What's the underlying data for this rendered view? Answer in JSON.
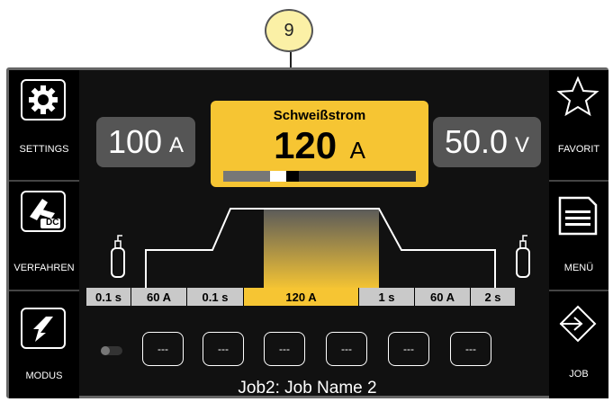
{
  "callout": {
    "number": "9"
  },
  "left_menu": [
    {
      "label": "SETTINGS",
      "icon": "gear-icon"
    },
    {
      "label": "VERFAHREN",
      "icon": "torch-dc-icon",
      "badge": "DC"
    },
    {
      "label": "MODUS",
      "icon": "mode-arrow-icon"
    }
  ],
  "right_menu": [
    {
      "label": "FAVORIT",
      "icon": "star-icon"
    },
    {
      "label": "MENÜ",
      "icon": "menu-document-icon"
    },
    {
      "label": "JOB",
      "icon": "job-arrow-icon"
    }
  ],
  "display": {
    "left_value": {
      "value": "100",
      "unit": "A"
    },
    "main": {
      "title": "Schweißstrom",
      "value": "120",
      "unit": "A"
    },
    "right_value": {
      "value": "50.0",
      "unit": "V"
    }
  },
  "sequence": [
    "0.1 s",
    "60 A",
    "0.1 s",
    "120 A",
    "1 s",
    "60 A",
    "2 s"
  ],
  "job_slots": [
    "---",
    "---",
    "---",
    "---",
    "---",
    "---"
  ],
  "job_name": "Job2: Job Name 2",
  "colors": {
    "accent": "#f6c533",
    "background": "#000000",
    "segment": "#c9c9c9"
  }
}
